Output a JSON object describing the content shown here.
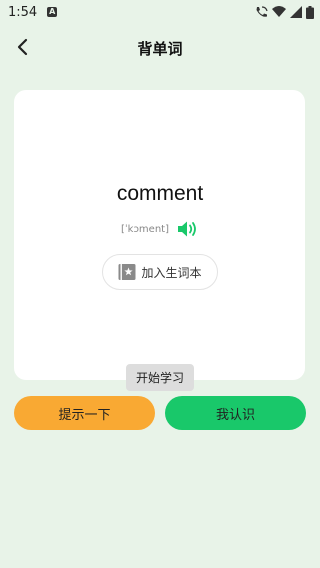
{
  "status_bar": {
    "time": "1:54",
    "app_badge": "A",
    "icons": [
      "wifi-call-icon",
      "wifi-icon",
      "signal-icon",
      "battery-icon"
    ]
  },
  "header": {
    "title": "背单词",
    "back_icon": "chevron-left-icon"
  },
  "card": {
    "word": "comment",
    "phonetic": "[ˈkɔment]",
    "speaker_icon": "speaker-icon",
    "add_wordbook_label": "加入生词本",
    "add_wordbook_icon": "wordbook-star-icon"
  },
  "tooltip": {
    "text": "开始学习"
  },
  "actions": {
    "hint_label": "提示一下",
    "know_label": "我认识"
  },
  "colors": {
    "background": "#e8f3e8",
    "hint_button": "#f9a933",
    "know_button": "#19c86a",
    "speaker": "#19c86a"
  }
}
